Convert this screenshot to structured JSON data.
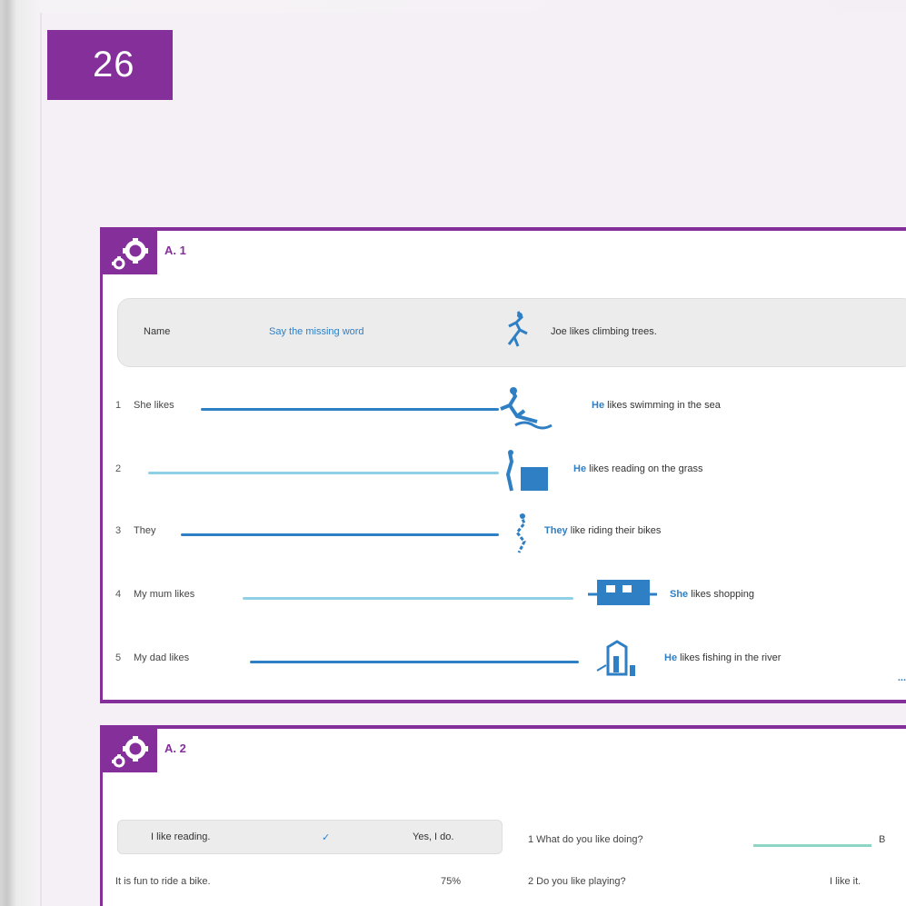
{
  "page": {
    "number": "26"
  },
  "section1": {
    "title": "A. 1",
    "legend": {
      "label": "Name",
      "hint": "Say the missing word",
      "example": "Joe likes climbing trees."
    },
    "rows": [
      {
        "q": "1",
        "word": "She likes",
        "answer_pre": "He",
        "answer": "likes swimming in the sea"
      },
      {
        "q": "2",
        "word": "",
        "answer_pre": "He",
        "answer": "likes reading on the grass"
      },
      {
        "q": "3",
        "word": "They",
        "answer_pre": "They",
        "answer": "like riding their bikes"
      },
      {
        "q": "4",
        "word": "My mum likes",
        "answer_pre": "She",
        "answer": "likes shopping"
      },
      {
        "q": "5",
        "word": "My dad likes",
        "answer_pre": "He",
        "answer": "likes fishing in the river"
      }
    ],
    "more": "..."
  },
  "section2": {
    "title": "A. 2",
    "box": {
      "left": "I like reading.",
      "mid": "✓",
      "right": "Yes, I do."
    },
    "right_line": "1 What do you like doing?",
    "right_end": "B",
    "row2_left": "It is fun to ride a bike.",
    "row2_mid": "75%",
    "row2_right": "2 Do you like playing?",
    "row2_end": "I like it."
  },
  "colors": {
    "accent": "#85309a",
    "blue": "#2f7fc4",
    "lightblue": "#8fd0e6",
    "teal": "#8ed6c4"
  }
}
